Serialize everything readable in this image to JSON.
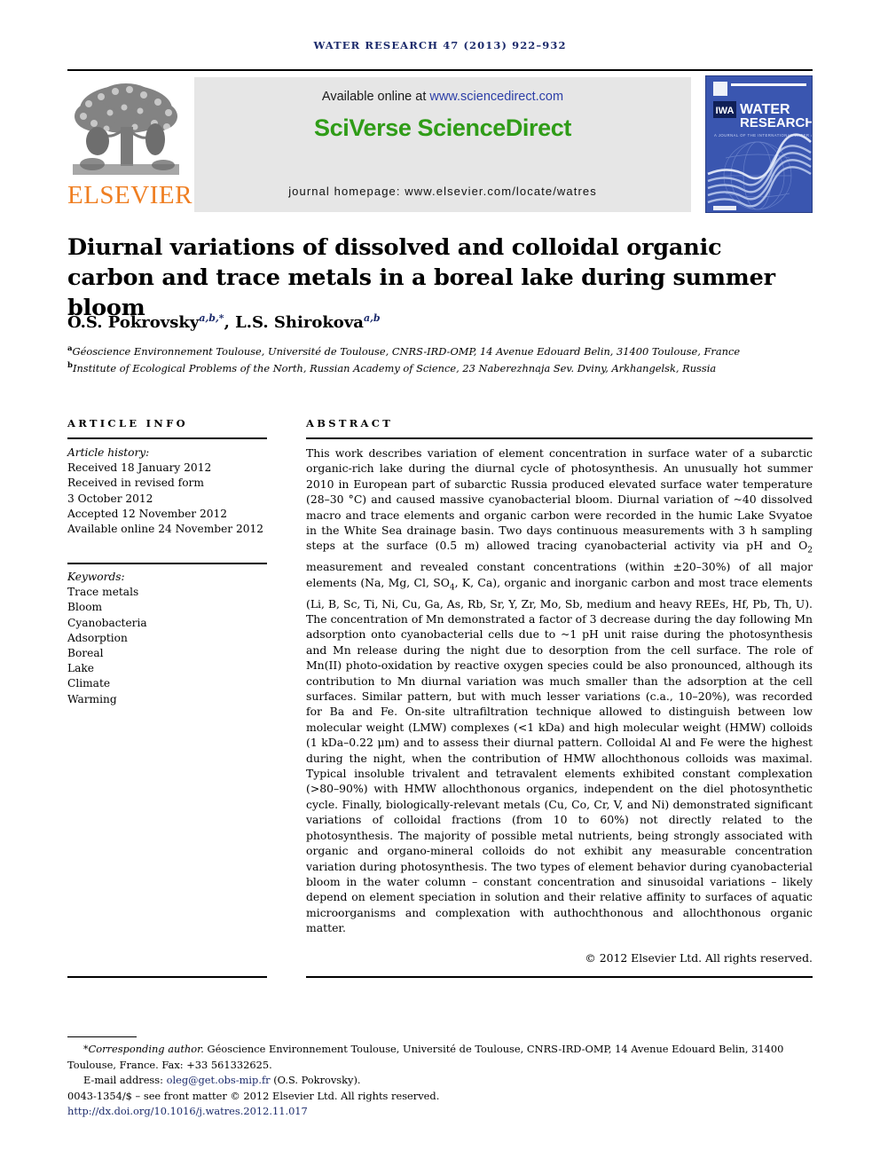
{
  "running_head": "WATER RESEARCH 47 (2013) 922–932",
  "masthead": {
    "publisher_name": "ELSEVIER",
    "available_prefix": "Available online at ",
    "available_link": "www.sciencedirect.com",
    "platform_title": "SciVerse ScienceDirect",
    "homepage": "journal homepage: www.elsevier.com/locate/watres",
    "cover": {
      "journal_line1": "WATER",
      "journal_line2": "RESEARCH",
      "society_mark": "IWA",
      "tagline": "A JOURNAL OF THE INTERNATIONAL WATER ASSOCIATION"
    },
    "colors": {
      "elsevier_orange": "#ef7e21",
      "sciencedirect_green": "#2f9c17",
      "link_blue": "#2d3fa8",
      "banner_grey": "#e6e6e6",
      "cover_blue": "#3a56b0",
      "running_head_navy": "#1b2a6b"
    }
  },
  "article": {
    "title": "Diurnal variations of dissolved and colloidal organic carbon and trace metals in a boreal lake during summer bloom",
    "authors": [
      {
        "name": "O.S. Pokrovsky",
        "marks": "a,b,*"
      },
      {
        "name": "L.S. Shirokova",
        "marks": "a,b"
      }
    ],
    "affiliations": [
      {
        "mark": "a",
        "text": "Géoscience Environnement Toulouse, Université de Toulouse, CNRS-IRD-OMP, 14 Avenue Edouard Belin, 31400 Toulouse, France"
      },
      {
        "mark": "b",
        "text": "Institute of Ecological Problems of the North, Russian Academy of Science, 23 Naberezhnaja Sev. Dviny, Arkhangelsk, Russia"
      }
    ]
  },
  "sections": {
    "info_heading": "ARTICLE INFO",
    "abstract_heading": "ABSTRACT"
  },
  "history": {
    "label": "Article history:",
    "lines": [
      "Received 18 January 2012",
      "Received in revised form",
      "3 October 2012",
      "Accepted 12 November 2012",
      "Available online 24 November 2012"
    ]
  },
  "keywords": {
    "label": "Keywords:",
    "items": [
      "Trace metals",
      "Bloom",
      "Cyanobacteria",
      "Adsorption",
      "Boreal",
      "Lake",
      "Climate",
      "Warming"
    ]
  },
  "abstract": {
    "part1": "This work describes variation of element concentration in surface water of a subarctic organic-rich lake during the diurnal cycle of photosynthesis. An unusually hot summer 2010 in European part of subarctic Russia produced elevated surface water temperature (28–30 °C) and caused massive cyanobacterial bloom. Diurnal variation of ~40 dissolved macro and trace elements and organic carbon were recorded in the humic Lake Svyatoe in the White Sea drainage basin. Two days continuous measurements with 3 h sampling steps at the surface (0.5 m) allowed tracing cyanobacterial activity via pH and O",
    "sub1": "2",
    "part2": " measurement and revealed constant concentrations (within ±20–30%) of all major elements (Na, Mg, Cl, SO",
    "sub2": "4",
    "part3": ", K, Ca), organic and inorganic carbon and most trace elements (Li, B, Sc, Ti, Ni, Cu, Ga, As, Rb, Sr, Y, Zr, Mo, Sb, medium and heavy REEs, Hf, Pb, Th, U). The concentration of Mn demonstrated a factor of 3 decrease during the day following Mn adsorption onto cyanobacterial cells due to ~1 pH unit raise during the photosynthesis and Mn release during the night due to desorption from the cell surface. The role of Mn(II) photo-oxidation by reactive oxygen species could be also pronounced, although its contribution to Mn diurnal variation was much smaller than the adsorption at the cell surfaces. Similar pattern, but with much lesser variations (c.a., 10–20%), was recorded for Ba and Fe. On-site ultrafiltration technique allowed to distinguish between low molecular weight (LMW) complexes (<1 kDa) and high molecular weight (HMW) colloids (1 kDa–0.22 μm) and to assess their diurnal pattern. Colloidal Al and Fe were the highest during the night, when the contribution of HMW allochthonous colloids was maximal. Typical insoluble trivalent and tetravalent elements exhibited constant complexation (>80–90%) with HMW allochthonous organics, independent on the diel photosynthetic cycle. Finally, biologically-relevant metals (Cu, Co, Cr, V, and Ni) demonstrated significant variations of colloidal fractions (from 10 to 60%) not directly related to the photosynthesis. The majority of possible metal nutrients, being strongly associated with organic and organo-mineral colloids do not exhibit any measurable concentration variation during photosynthesis. The two types of element behavior during cyanobacterial bloom in the water column – constant concentration and sinusoidal variations – likely depend on element speciation in solution and their relative affinity to surfaces of aquatic microorganisms and complexation with authochthonous and allochthonous organic matter.",
    "copyright": "© 2012 Elsevier Ltd. All rights reserved."
  },
  "footnote": {
    "star": "*",
    "corresponding_label": "Corresponding author.",
    "corresponding_address": " Géoscience Environnement Toulouse, Université de Toulouse, CNRS-IRD-OMP, 14 Avenue Edouard Belin, 31400 Toulouse, France. Fax: +33 561332625.",
    "email_label": "E-mail address: ",
    "email": "oleg@get.obs-mip.fr",
    "email_suffix": " (O.S. Pokrovsky).",
    "issn_line": "0043-1354/$ – see front matter © 2012 Elsevier Ltd. All rights reserved.",
    "doi": "http://dx.doi.org/10.1016/j.watres.2012.11.017"
  }
}
